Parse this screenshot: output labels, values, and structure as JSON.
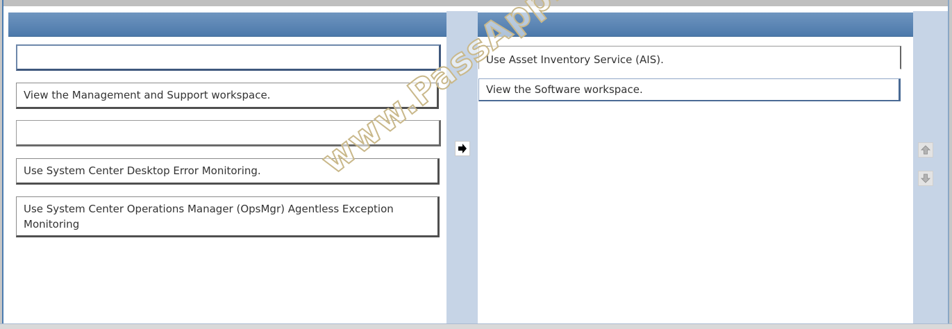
{
  "source_items": [
    {
      "label": ""
    },
    {
      "label": "View the Management and Support workspace."
    },
    {
      "label": ""
    },
    {
      "label": "Use System Center Desktop Error Monitoring."
    },
    {
      "label": "Use System Center Operations Manager (OpsMgr) Agentless Exception Monitoring"
    }
  ],
  "answer_items": [
    {
      "label": "Use Asset Inventory Service (AIS)."
    },
    {
      "label": "View the Software workspace."
    }
  ],
  "controls": {
    "move_right": "arrow-right-icon",
    "move_left": "arrow-left-icon",
    "move_up": "arrow-up-icon",
    "move_down": "arrow-down-icon"
  },
  "watermark": "www.PassApply.com",
  "colors": {
    "header": "#5a82b0",
    "gutter": "#c6d4e6"
  }
}
